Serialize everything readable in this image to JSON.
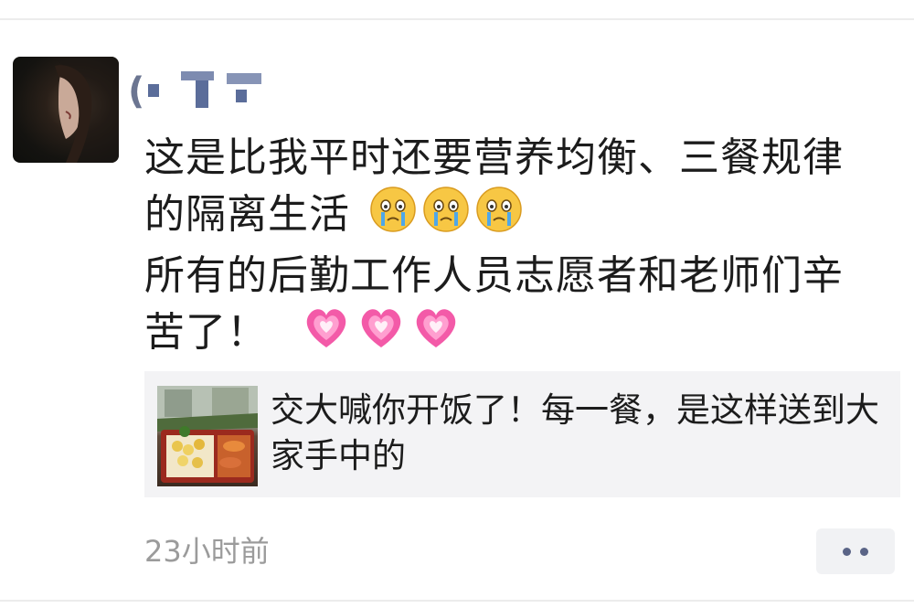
{
  "post": {
    "author_name": "(",
    "text_lines": [
      "这是比我平时还要营养均衡、三餐规律",
      "的隔离生活",
      "所有的后勤工作人员志愿者和老师们辛",
      "苦了！"
    ],
    "line2_emojis": [
      "crying-face-icon",
      "crying-face-icon",
      "crying-face-icon"
    ],
    "line4_emojis": [
      "sparkling-heart-icon",
      "sparkling-heart-icon",
      "sparkling-heart-icon"
    ],
    "link_card": {
      "title": "交大喊你开饭了！每一餐，是这样送到大家手中的"
    },
    "timestamp": "23小时前",
    "more_icon": "more-dots-icon"
  },
  "colors": {
    "name": "#5b6d9a",
    "text": "#1c1c1c",
    "meta": "#9b9b9b",
    "card_bg": "#f3f3f5",
    "heart": "#f04aa0"
  }
}
